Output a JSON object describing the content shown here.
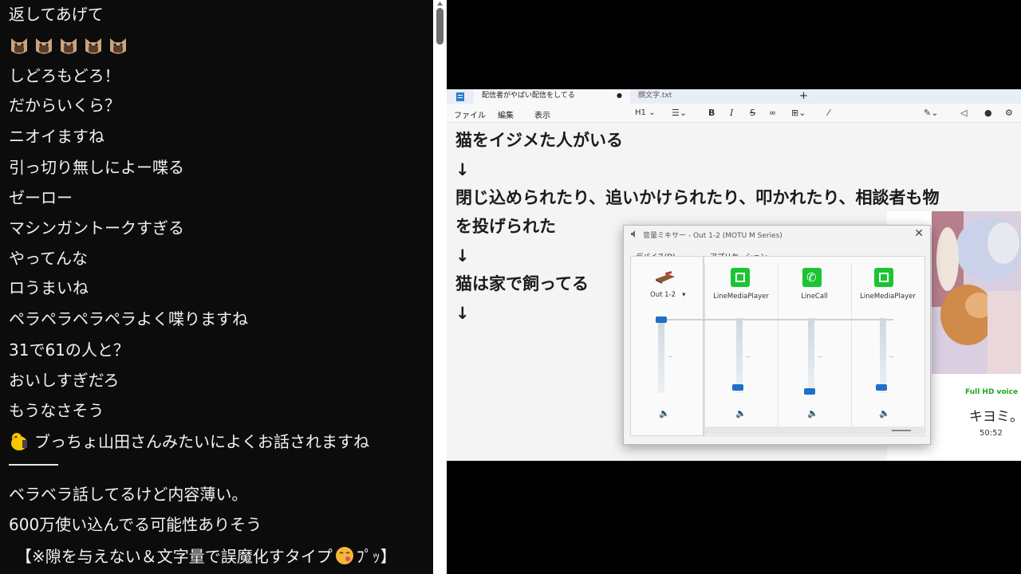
{
  "chat": {
    "messages": [
      "返してあげて",
      "",
      "しどろもどろ！",
      "だからいくら？",
      "ニオイますね",
      "引っ切り無しによー喋る",
      "ゼーロー",
      "マシンガントークすぎる",
      "やってんな",
      "ロうまいね",
      "ペラペラペラペラよく喋りますね",
      "31で61の人と？",
      "おいしすぎだろ",
      "もうなさそう",
      "ブっちょ山田さんみたいによくお話されますね",
      "ベラベラ話してるけど内容薄い。",
      "600万使い込んでる可能性ありそう",
      "【※隙を与えない＆文字量で誤魔化すタイプ",
      "ﾌﾟｯ】"
    ],
    "cat_emoji_count": 5
  },
  "notepad": {
    "tabs": [
      "配信者がやばい配信をしてる",
      "顔文字.txt",
      "+"
    ],
    "tab_dot": "●",
    "menu": [
      "ファイル",
      "編集",
      "表示"
    ],
    "heading_select": "H1",
    "lines": [
      "猫をイジメた人がいる",
      "↓",
      "閉じ込められたり、追いかけられたり、叩かれたり、相談者も物",
      "を投げられた",
      "↓",
      "猫は家で飼ってる",
      "↓"
    ]
  },
  "mixer": {
    "title": "音量ミキサー - Out 1-2 (MOTU M Series)",
    "device_section": "デバイス(D)",
    "app_section": "アプリケーション",
    "device_name": "Out 1-2",
    "apps": [
      "LineMediaPlayer",
      "LineCall",
      "LineMediaPlayer"
    ],
    "levels": {
      "device": 1.0,
      "app1": 0.08,
      "app2": 0.02,
      "app3": 0.08
    }
  },
  "webcam": {
    "label": "Full HD voice",
    "name": "キヨミ。",
    "time": "50:52"
  }
}
